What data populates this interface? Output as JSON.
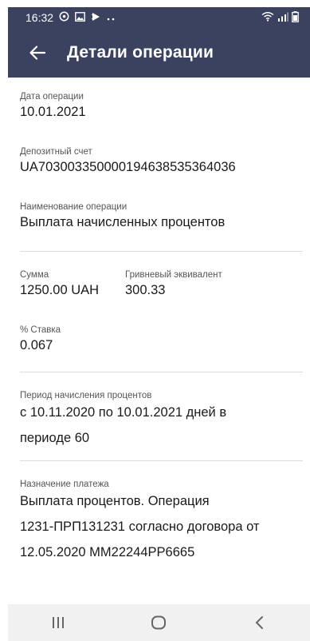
{
  "status_bar": {
    "time": "16:32",
    "left_icons": [
      "whatsapp-icon",
      "gallery-icon",
      "play-icon",
      "more-dots-icon"
    ],
    "right_icons": [
      "wifi-icon",
      "signal-icon",
      "battery-icon"
    ]
  },
  "header": {
    "title": "Детали операции",
    "back_icon": "arrow-left-icon"
  },
  "details": {
    "date_label": "Дата операции",
    "date_value": "10.01.2021",
    "account_label": "Депозитный счет",
    "account_value": "UA703003350000194638535364036",
    "operation_name_label": "Наименование операции",
    "operation_name_value": "Выплата начисленных процентов",
    "amount_label": "Сумма",
    "amount_value": "1250.00  UAH",
    "hryvnia_equiv_label": "Гривневый эквивалент",
    "hryvnia_equiv_value": "300.33",
    "rate_label": "% Ставка",
    "rate_value": "0.067",
    "period_label": "Период начисления процентов",
    "period_value_line1": "с 10.11.2020 по 10.01.2021 дней в",
    "period_value_line2": "периоде 60",
    "purpose_label": "Назначение платежа",
    "purpose_value_line1": "Выплата процентов. Операция",
    "purpose_value_line2": "1231-ПРП131231 согласно договора от",
    "purpose_value_line3": "12.05.2020 ММ22244РР6665"
  },
  "nav_bar": {
    "buttons": [
      "recent-apps-icon",
      "home-icon",
      "back-icon"
    ]
  },
  "colors": {
    "header_bg": "#3a4260",
    "divider": "#dcdcdc",
    "nav_bg": "#f1f1f1"
  }
}
